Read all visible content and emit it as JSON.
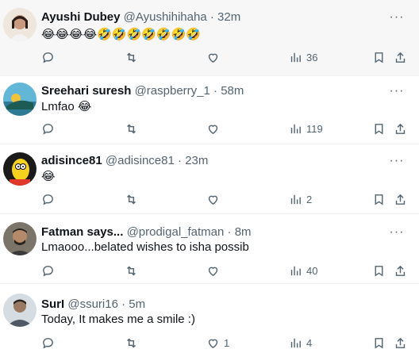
{
  "tweets": [
    {
      "name": "Ayushi Dubey",
      "handle": "@Ayushihihaha",
      "dot": "·",
      "time": "32m",
      "text": "😂😂😂😂🤣🤣🤣🤣🤣🤣🤣",
      "views": "36",
      "likes": ""
    },
    {
      "name": "Sreehari suresh",
      "handle": "@raspberry_1",
      "dot": "·",
      "time": "58m",
      "text": "Lmfao 😂",
      "views": "119",
      "likes": ""
    },
    {
      "name": "adisince81",
      "handle": "@adisince81",
      "dot": "·",
      "time": "23m",
      "text": "😂",
      "views": "2",
      "likes": ""
    },
    {
      "name": "Fatman says...",
      "handle": "@prodigal_fatman",
      "dot": "·",
      "time": "8m",
      "text": "Lmaooo...belated wishes to isha possib",
      "views": "40",
      "likes": ""
    },
    {
      "name": "SurI",
      "handle": "@ssuri16",
      "dot": "·",
      "time": "5m",
      "text": "Today, It makes me a smile :)",
      "views": "4",
      "likes": "1"
    }
  ],
  "icons": {
    "reply": "reply-icon",
    "retweet": "retweet-icon",
    "like": "heart-icon",
    "views": "views-icon",
    "bookmark": "bookmark-icon",
    "share": "share-icon",
    "more": "more-icon"
  },
  "colors": {
    "text": "#0f1419",
    "muted": "#536471",
    "divider": "#eff3f4"
  }
}
